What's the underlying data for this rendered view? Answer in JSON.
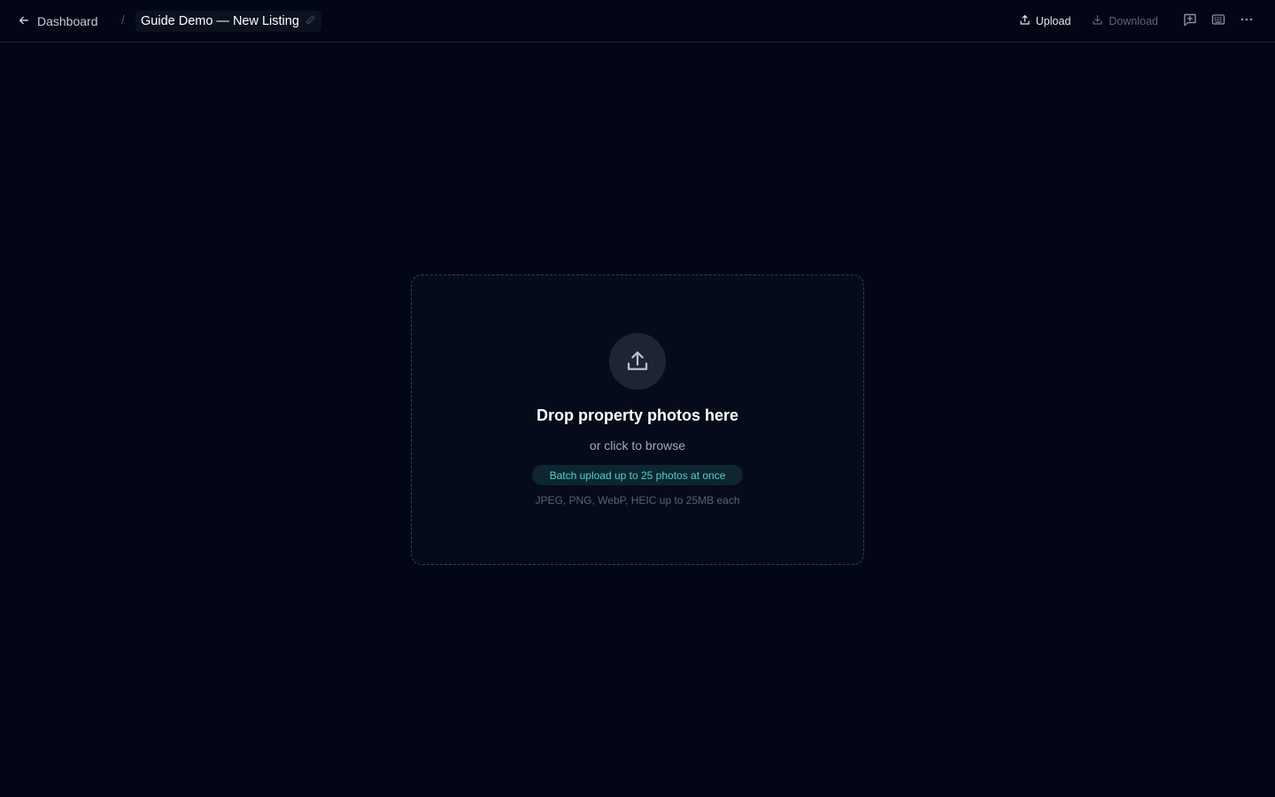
{
  "header": {
    "back_label": "Dashboard",
    "separator": "/",
    "document_title": "Guide Demo — New Listing",
    "upload_label": "Upload",
    "download_label": "Download"
  },
  "dropzone": {
    "title": "Drop property photos here",
    "subtitle": "or click to browse",
    "badge": "Batch upload up to 25 photos at once",
    "formats": "JPEG, PNG, WebP, HEIC up to 25MB each"
  },
  "icons": {
    "back": "arrow-left-icon",
    "edit": "pencil-icon",
    "upload": "upload-icon",
    "download": "download-icon",
    "feedback": "message-plus-icon",
    "keyboard": "keyboard-icon",
    "more": "more-horizontal-icon",
    "dropzone": "upload-tray-icon"
  },
  "colors": {
    "background": "#030615",
    "dropzone_bg": "#060b1b",
    "accent_teal": "#4fd0cc",
    "disabled_text": "#5d6477"
  }
}
